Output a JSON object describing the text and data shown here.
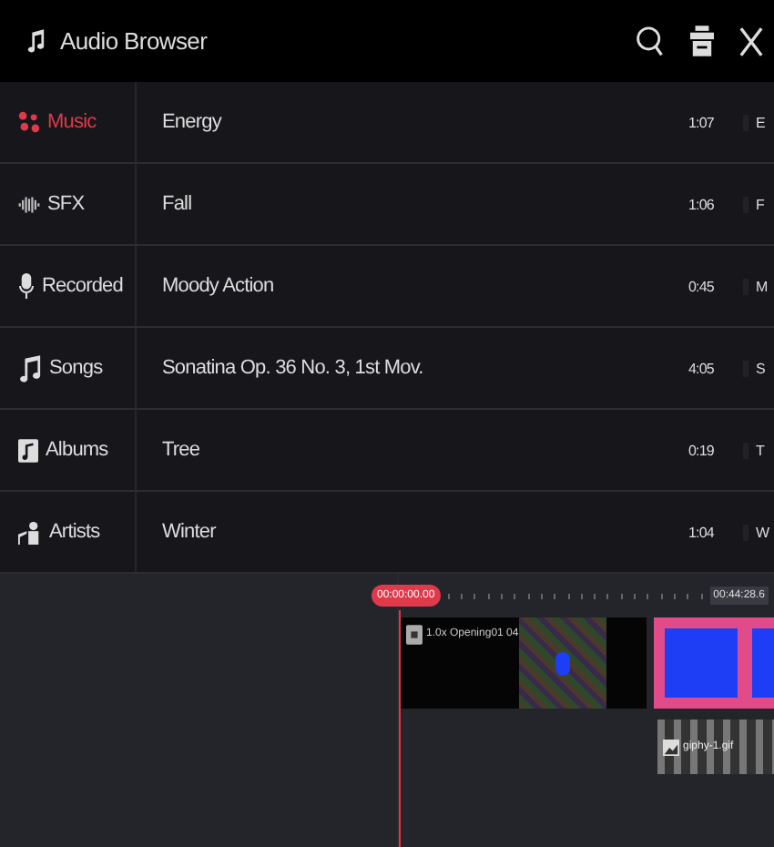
{
  "header": {
    "title": "Audio Browser"
  },
  "categories": [
    {
      "label": "Music",
      "selected": true,
      "kind": "music"
    },
    {
      "label": "SFX",
      "selected": false,
      "kind": "sfx"
    },
    {
      "label": "Recorded",
      "selected": false,
      "kind": "mic"
    },
    {
      "label": "Songs",
      "selected": false,
      "kind": "songs"
    },
    {
      "label": "Albums",
      "selected": false,
      "kind": "albums"
    },
    {
      "label": "Artists",
      "selected": false,
      "kind": "artists"
    }
  ],
  "tracks": [
    {
      "title": "Energy",
      "duration": "1:07",
      "column_3": "E"
    },
    {
      "title": "Fall",
      "duration": "1:06",
      "column_3": "F"
    },
    {
      "title": "Moody Action",
      "duration": "0:45",
      "column_3": "M"
    },
    {
      "title": "Sonatina Op. 36 No. 3, 1st Mov.",
      "duration": "4:05",
      "column_3": "S"
    },
    {
      "title": "Tree",
      "duration": "0:19",
      "column_3": "T"
    },
    {
      "title": "Winter",
      "duration": "1:04",
      "column_3": "W"
    }
  ],
  "timeline": {
    "playhead_time": "00:00:00.00",
    "end_time": "00:44:28.6",
    "video_clip": "1.0x Opening01 04",
    "gif_clip": "giphy-1.gif"
  }
}
